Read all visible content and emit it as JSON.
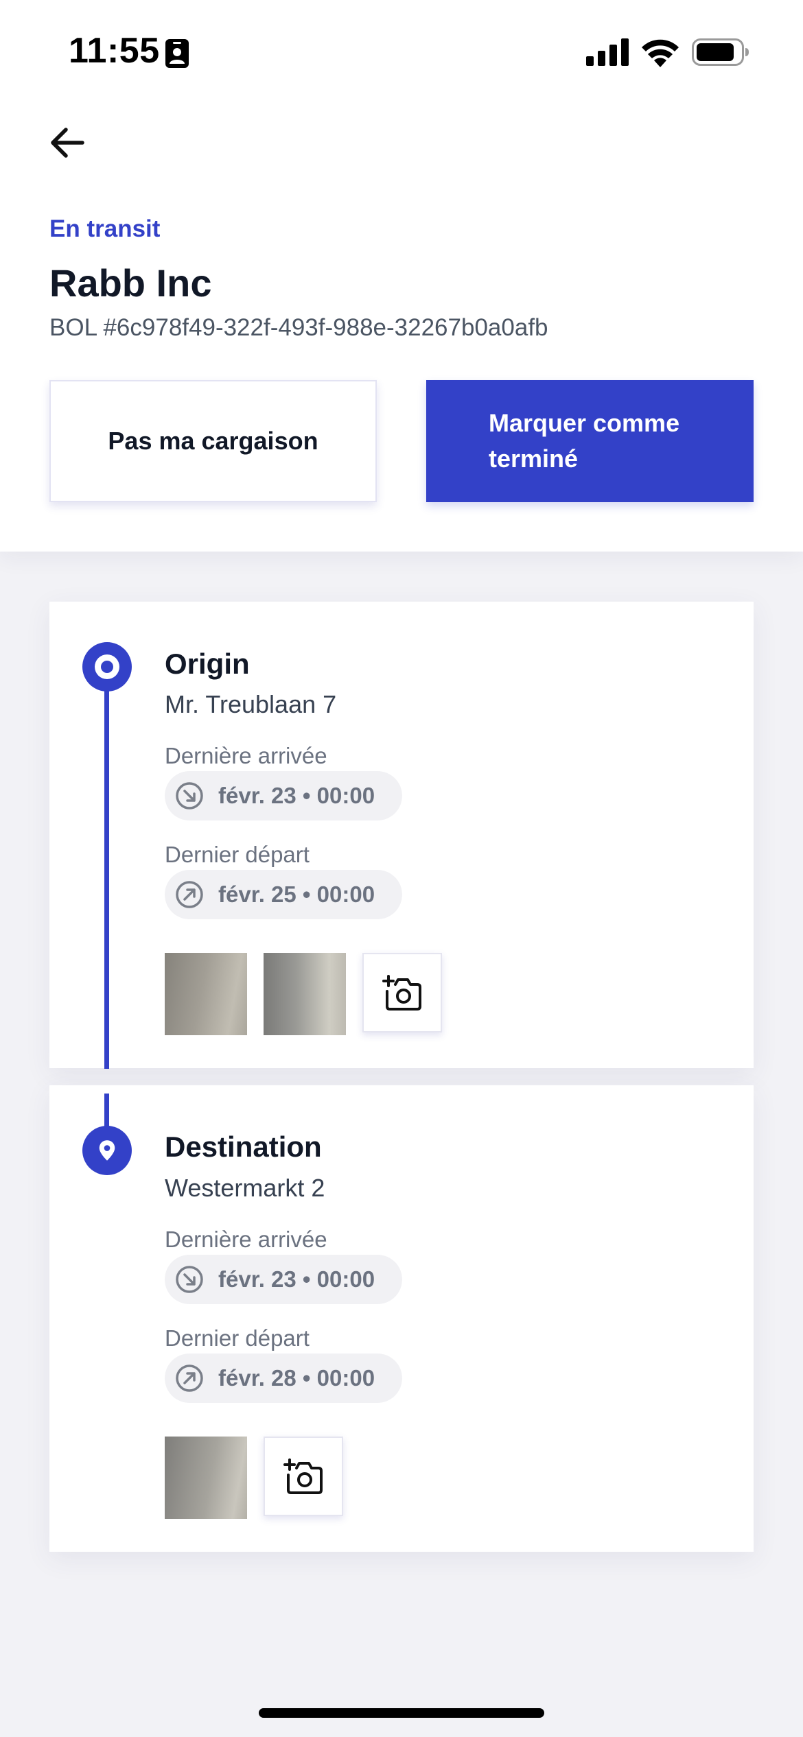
{
  "status_bar": {
    "time": "11:55",
    "icons": [
      "contact-card-icon",
      "cellular-signal-icon",
      "wifi-icon",
      "battery-icon"
    ]
  },
  "header": {
    "back_icon": "arrow-left-icon",
    "status": "En transit",
    "shipper": "Rabb Inc",
    "bol": "BOL #6c978f49-322f-493f-988e-32267b0a0afb"
  },
  "actions": {
    "not_my_shipment": "Pas ma cargaison",
    "mark_complete": "Marquer comme terminé"
  },
  "stops": [
    {
      "title": "Origin",
      "address": "Mr. Treublaan 7",
      "arrival_label": "Dernière arrivée",
      "arrival_value": "févr. 23 • 00:00",
      "departure_label": "Dernier départ",
      "departure_value": "févr. 25 • 00:00",
      "photo_count": 2,
      "icon": "origin-ring-icon"
    },
    {
      "title": "Destination",
      "address": "Westermarkt 2",
      "arrival_label": "Dernière arrivée",
      "arrival_value": "févr. 23 • 00:00",
      "departure_label": "Dernier départ",
      "departure_value": "févr. 28 • 00:00",
      "photo_count": 1,
      "icon": "location-pin-icon"
    }
  ],
  "colors": {
    "accent": "#3341c8",
    "background": "#f2f2f6",
    "text_primary": "#111827",
    "text_muted": "#6b7280",
    "chip_bg": "#f1f1f4"
  }
}
